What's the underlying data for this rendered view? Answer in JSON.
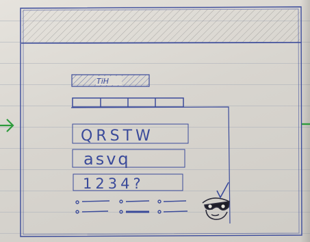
{
  "sketch": {
    "title_bar_text": "TiH",
    "captcha_lines": [
      "QRSTW",
      "asvq",
      "1234?"
    ]
  },
  "colors": {
    "ink": "#3a4a9a",
    "arrow": "#2d9b3c",
    "paper": "#dedbd5"
  }
}
